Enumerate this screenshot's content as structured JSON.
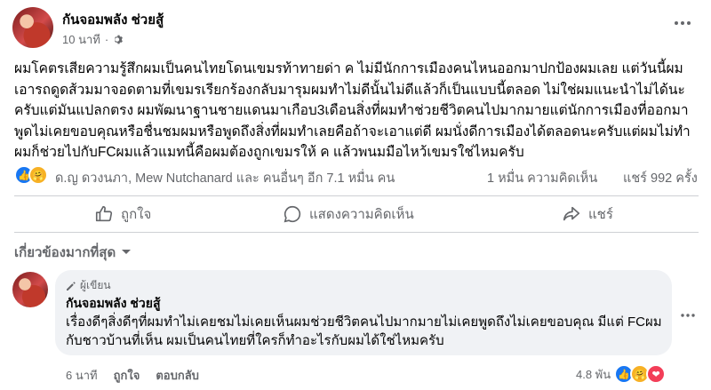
{
  "post": {
    "author": "กันจอมพลัง ช่วยสู้",
    "time": "10 นาที",
    "body": "ผมโคตรเสียความรู้สึกผมเป็นคนไทยโดนเขมรท้าทายด่า ค ไม่มีนักการเมืองคนไหนออกมาปกป้องผมเลย แต่วันนี้ผมเอารถดูดส้วมมาจอดตามที่เขมรเรียกร้องกลับมารุมผมทำไม่ดีนั้นไม่ดีแล้วก็เป็นแบบนี้ตลอด ไม่ใช่ผมแนะนำไม่ได้นะครับแต่มันแปลกตรง ผมพัฒนาฐานชายแดนมาเกือบ3เดือนสิ่งที่ผมทำช่วยชีวิตคนไปมากมายแต่นักการเมืองที่ออกมาพูดไม่เคยขอบคุณหรือชื่นชมผมหรือพูดถึงสิ่งที่ผมทำเลยคือถ้าจะเอาแต่ดี ผมนั่งดีการเมืองได้ตลอดนะครับแต่ผมไม่ทำ ผมก็ช่วยไปกับFCผมแล้วแมทนี้คือผมต้องถูกเขมรให้ ค แล้วพนมมือไหว้เขมรใช่ไหมครับ",
    "reactions_text": "ด.ญ ดวงนภา, Mew Nutchanard และ คนอื่นๆ อีก 7.1 หมื่น คน",
    "comments_count": "1 หมื่น ความคิดเห็น",
    "shares_count": "แชร์ 992 ครั้ง"
  },
  "actions": {
    "like": "ถูกใจ",
    "comment": "แสดงความคิดเห็น",
    "share": "แชร์"
  },
  "filter": {
    "label": "เกี่ยวข้องมากที่สุด"
  },
  "comment": {
    "badge": "ผู้เขียน",
    "author": "กันจอมพลัง ช่วยสู้",
    "text": "เรื่องดีๆสิ่งดีๆที่ผมทำไม่เคยชมไม่เคยเห็นผมช่วยชีวิตคนไปมากมายไม่เคยพูดถึงไม่เคยขอบคุณ มีแต่ FCผมกับชาวบ้านที่เห็น ผมเป็นคนไทยที่ใครก็ทำอะไรกับผมได้ใช่ไหมครับ",
    "time": "6 นาที",
    "like": "ถูกใจ",
    "reply": "ตอบกลับ",
    "reaction_count": "4.8 พัน"
  },
  "colors": {
    "like_blue": "#1877f2",
    "care_yellow": "#f7b125",
    "love_red": "#f33e58",
    "muted_gray": "#65676b"
  },
  "icons": {
    "privacy": "gear-icon",
    "more": "more-dots-icon",
    "like": "thumbs-up-icon",
    "comment": "speech-bubble-icon",
    "share": "share-arrow-icon",
    "dropdown": "caret-down-icon",
    "author_badge": "pencil-icon"
  }
}
